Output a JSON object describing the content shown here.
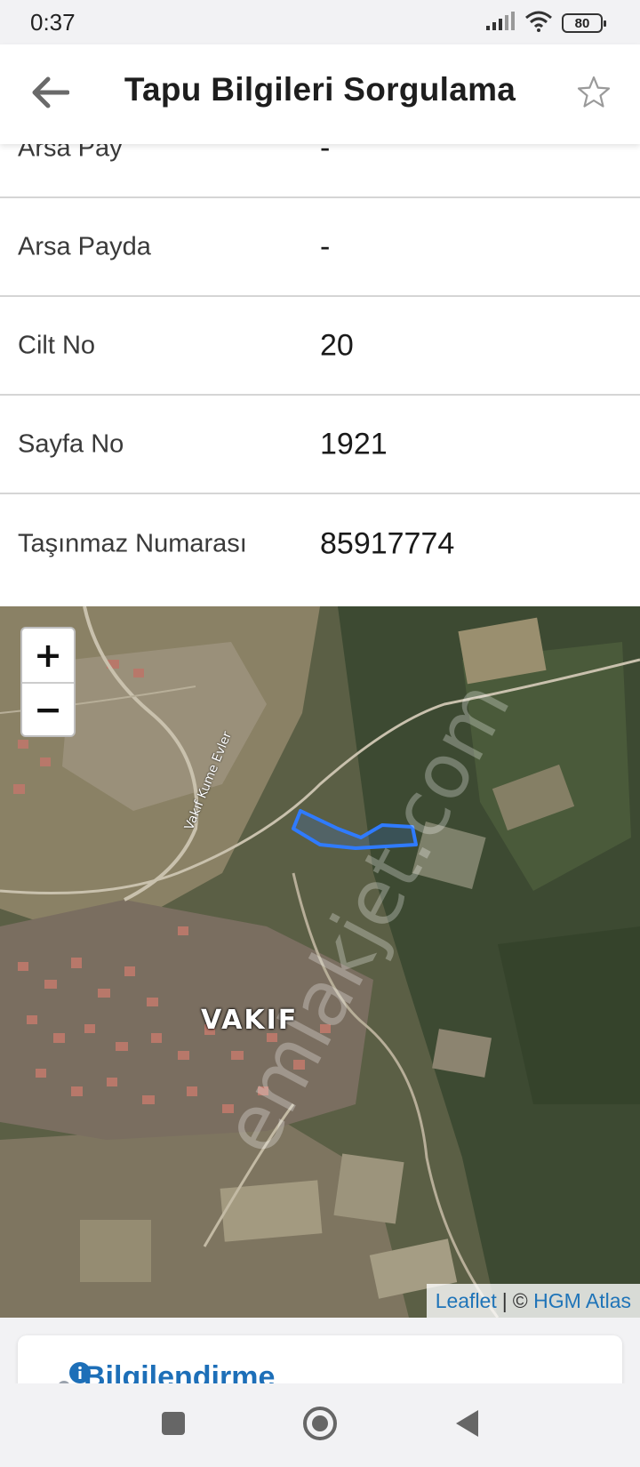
{
  "status_bar": {
    "time": "0:37",
    "battery": "80",
    "signal_icon": "signal-icon",
    "wifi_icon": "wifi-icon"
  },
  "header": {
    "title": "Tapu Bilgileri Sorgulama",
    "back_icon": "arrow-left-icon",
    "favorite_icon": "star-icon"
  },
  "info_rows": [
    {
      "label": "Arsa Pay",
      "value": "-"
    },
    {
      "label": "Arsa Payda",
      "value": "-"
    },
    {
      "label": "Cilt No",
      "value": "20"
    },
    {
      "label": "Sayfa No",
      "value": "1921"
    },
    {
      "label": "Taşınmaz Numarası",
      "value": "85917774"
    }
  ],
  "map": {
    "zoom_in": "+",
    "zoom_out": "−",
    "place_label": "VAKIF",
    "road_label": "Vakıf Kume Evler",
    "watermark": "emlakjet.com",
    "attribution": {
      "leaflet": "Leaflet",
      "separator": "|",
      "copyright": "©",
      "provider": "HGM Atlas"
    },
    "parcel_color": "#2f7bff"
  },
  "info_card": {
    "title": "Bilgilendirme",
    "icon": "info-person-icon"
  },
  "nav_bar": {
    "recent_icon": "square-icon",
    "home_icon": "circle-home-icon",
    "back_icon": "triangle-back-icon"
  }
}
